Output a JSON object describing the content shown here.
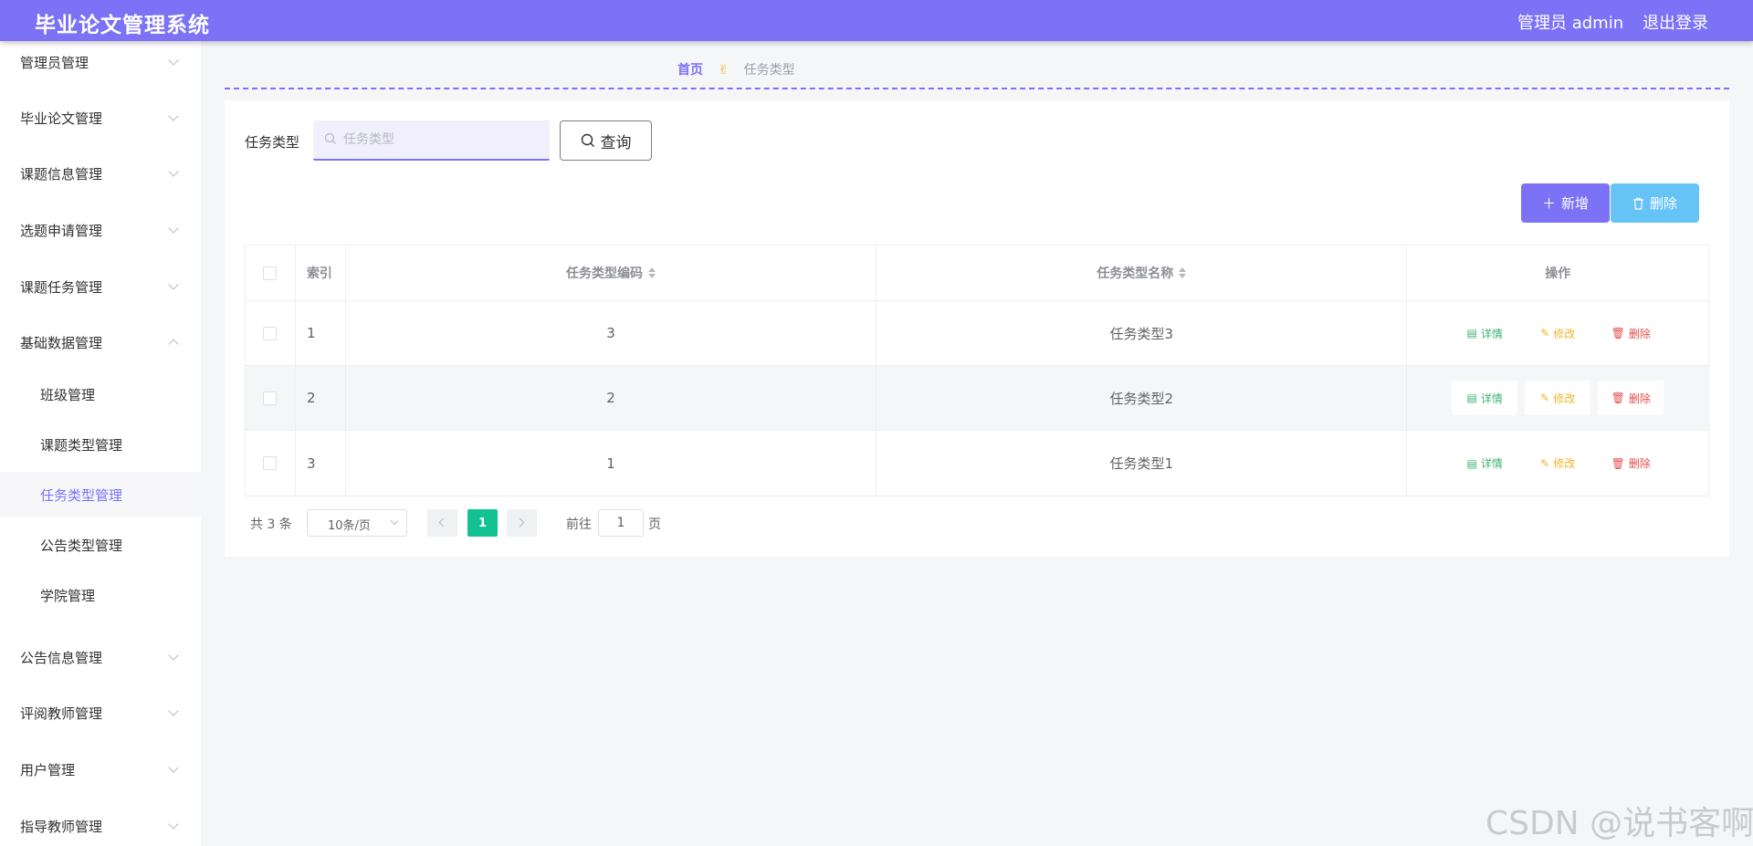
{
  "header": {
    "title": "毕业论文管理系统",
    "user": "管理员 admin",
    "logout": "退出登录"
  },
  "sidebar": {
    "items": [
      {
        "label": "管理员管理",
        "expanded": false
      },
      {
        "label": "毕业论文管理",
        "expanded": false
      },
      {
        "label": "课题信息管理",
        "expanded": false
      },
      {
        "label": "选题申请管理",
        "expanded": false
      },
      {
        "label": "课题任务管理",
        "expanded": false
      },
      {
        "label": "基础数据管理",
        "expanded": true,
        "children": [
          {
            "label": "班级管理"
          },
          {
            "label": "课题类型管理"
          },
          {
            "label": "任务类型管理",
            "active": true
          },
          {
            "label": "公告类型管理"
          },
          {
            "label": "学院管理"
          }
        ]
      },
      {
        "label": "公告信息管理",
        "expanded": false
      },
      {
        "label": "评阅教师管理",
        "expanded": false
      },
      {
        "label": "用户管理",
        "expanded": false
      },
      {
        "label": "指导教师管理",
        "expanded": false
      }
    ]
  },
  "breadcrumb": {
    "home": "首页",
    "separator": "✌",
    "current": "任务类型"
  },
  "search": {
    "label": "任务类型",
    "placeholder": "任务类型",
    "value": "",
    "query_button": "查询"
  },
  "actions": {
    "add": "新增",
    "delete": "删除"
  },
  "table": {
    "columns": [
      "索引",
      "任务类型编码",
      "任务类型名称",
      "操作"
    ],
    "rows": [
      {
        "index": "1",
        "code": "3",
        "name": "任务类型3"
      },
      {
        "index": "2",
        "code": "2",
        "name": "任务类型2"
      },
      {
        "index": "3",
        "code": "1",
        "name": "任务类型1"
      }
    ],
    "row_actions": {
      "detail": "详情",
      "edit": "修改",
      "remove": "删除"
    }
  },
  "pagination": {
    "total": "共 3 条",
    "page_size": "10条/页",
    "current_page": "1",
    "goto_label": "前往",
    "goto_value": "1",
    "page_suffix": "页"
  },
  "watermark": "CSDN @说书客啊",
  "colors": {
    "primary": "#7b72f6",
    "delete_button": "#66c3f5",
    "page_active": "#13c292",
    "detail": "#3cb371",
    "edit": "#f0b429",
    "remove": "#e4504f"
  }
}
